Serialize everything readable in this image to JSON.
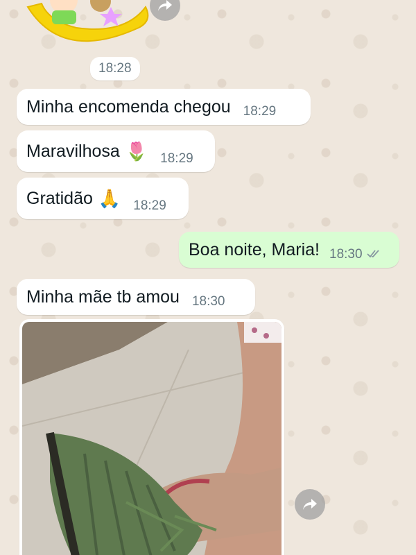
{
  "sticker": {
    "top_timestamp": "18:28"
  },
  "messages": [
    {
      "direction": "in",
      "text": "Minha encomenda chegou",
      "time": "18:29"
    },
    {
      "direction": "in",
      "text": "Maravilhosa",
      "emoji": "🌷",
      "time": "18:29"
    },
    {
      "direction": "in",
      "text": "Gratidão",
      "emoji": "🙏",
      "time": "18:29"
    },
    {
      "direction": "out",
      "text": "Boa noite, Maria!",
      "time": "18:30",
      "status": "read"
    },
    {
      "direction": "in",
      "text": "Minha mãe tb amou",
      "time": "18:30"
    }
  ],
  "photo": {
    "description_icon": "image"
  },
  "icons": {
    "forward": "forward-icon",
    "read_receipt": "double-check-icon"
  },
  "colors": {
    "background": "#efe7dd",
    "incoming": "#ffffff",
    "outgoing": "#d9fdd3",
    "timestamp": "#667781"
  }
}
